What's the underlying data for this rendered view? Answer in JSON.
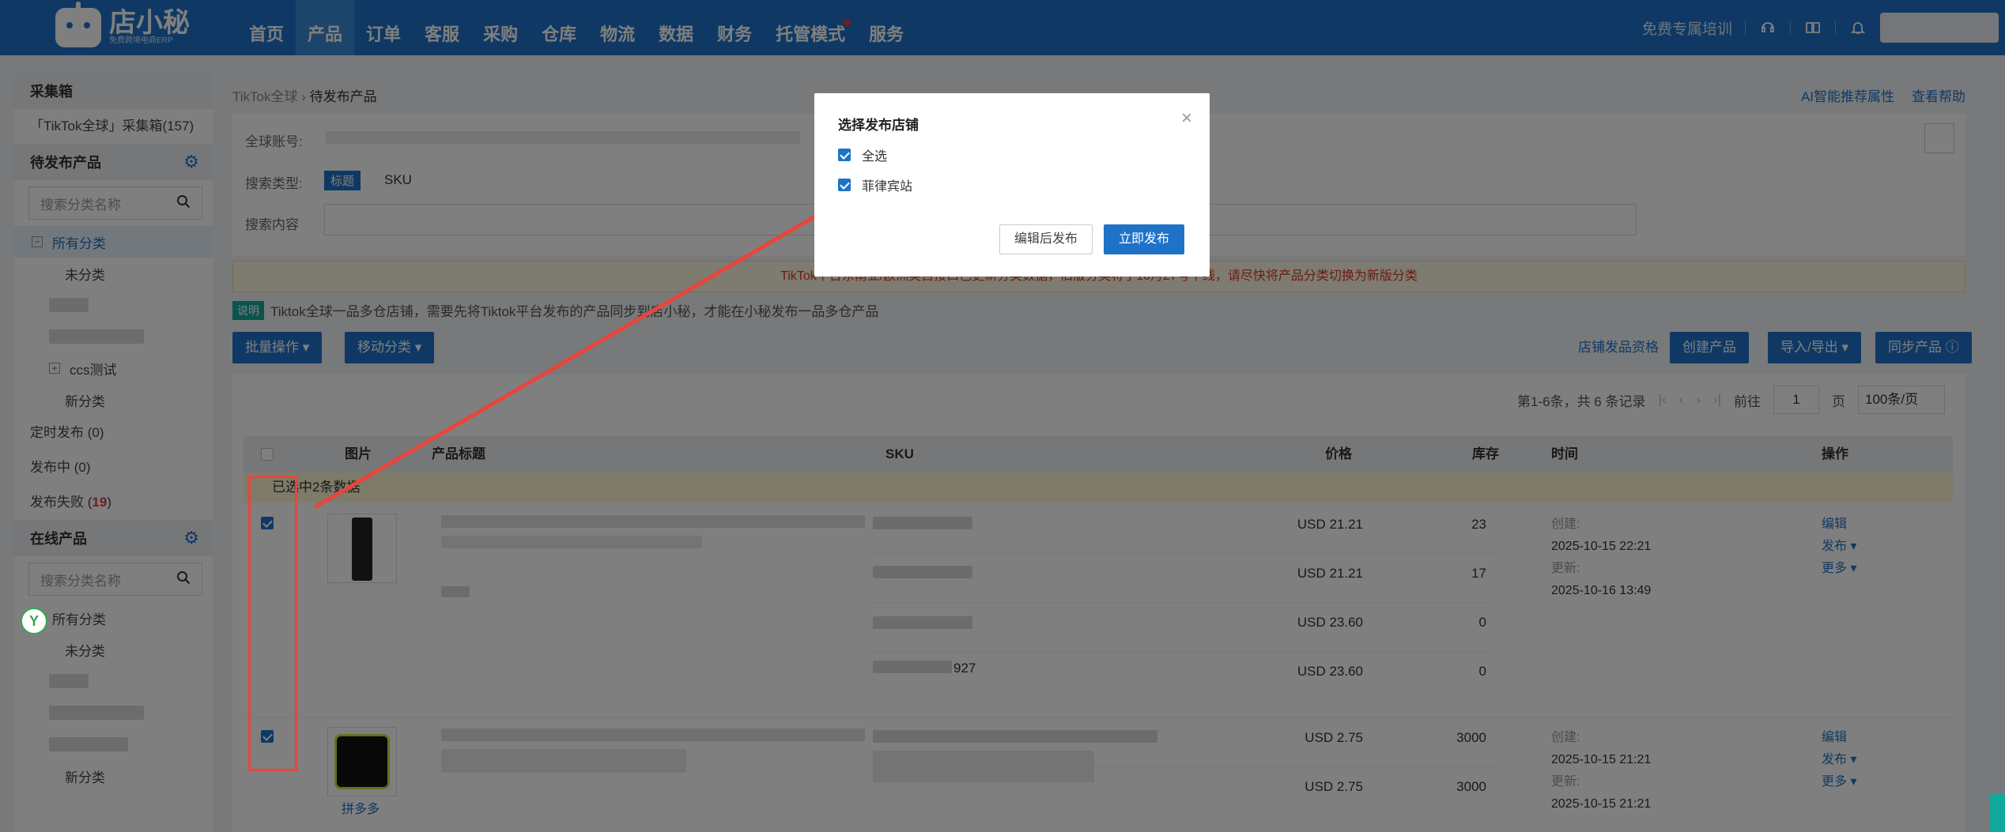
{
  "app": {
    "logo_text": "店小秘",
    "logo_sub": "免费跨境电商ERP"
  },
  "nav": {
    "items": [
      "首页",
      "产品",
      "订单",
      "客服",
      "采购",
      "仓库",
      "物流",
      "数据",
      "财务",
      "托管模式",
      "服务"
    ],
    "active": "产品",
    "training": "免费专属培训"
  },
  "sidebar": {
    "collect_title": "采集箱",
    "collect_item": "「TikTok全球」采集箱(157)",
    "pending_title": "待发布产品",
    "search_placeholder": "搜索分类名称",
    "pending_tree": [
      "所有分类",
      "未分类",
      "ccs测试",
      "新分类"
    ],
    "scheduled": "定时发布 (0)",
    "publishing": "发布中 (0)",
    "failed_label": "发布失败 (",
    "failed_count": "19",
    "failed_close": ")",
    "online_title": "在线产品",
    "online_tree": [
      "所有分类",
      "未分类",
      "新分类"
    ]
  },
  "breadcrumb": {
    "root": "TikTok全球",
    "current": "待发布产品"
  },
  "top_links": {
    "ai": "AI智能推荐属性",
    "help": "查看帮助"
  },
  "filters": {
    "account_label": "全球账号:",
    "search_type_label": "搜索类型:",
    "type_title": "标题",
    "type_sku": "SKU",
    "content_label": "搜索内容"
  },
  "notice": "TikTok平台东南亚/欧洲类目接口已更新分类数据，旧版分类将于10月27号下线，请尽快将产品分类切换为新版分类",
  "tip": {
    "tag": "说明",
    "text": "Tiktok全球一品多仓店铺，需要先将Tiktok平台发布的产品同步到店小秘，才能在小秘发布一品多仓产品"
  },
  "actions": {
    "batch": "批量操作 ▾",
    "move": "移动分类 ▾",
    "shop_qual": "店铺发品资格",
    "create": "创建产品",
    "import_export": "导入/导出 ▾",
    "sync": "同步产品 ⓘ"
  },
  "pager": {
    "summary": "第1-6条，共 6 条记录",
    "goto": "前往",
    "page": "1",
    "page_unit": "页",
    "per_page": "100条/页"
  },
  "table": {
    "headers": {
      "img": "图片",
      "title": "产品标题",
      "sku": "SKU",
      "price": "价格",
      "stock": "库存",
      "time": "时间",
      "ops": "操作"
    },
    "selected_msg": "已选中2条数据",
    "rows": [
      {
        "prices": [
          "USD 21.21",
          "USD 21.21",
          "USD 23.60",
          "USD 23.60"
        ],
        "stocks": [
          "23",
          "17",
          "0",
          "0"
        ],
        "sku_suffix": "927",
        "created_label": "创建:",
        "created": "2025-10-15 22:21",
        "updated_label": "更新:",
        "updated": "2025-10-16 13:49",
        "ops": [
          "编辑",
          "发布 ▾",
          "更多 ▾"
        ]
      },
      {
        "source": "拼多多",
        "prices": [
          "USD 2.75",
          "USD 2.75"
        ],
        "stocks": [
          "3000",
          "3000"
        ],
        "created_label": "创建:",
        "created": "2025-10-15 21:21",
        "updated_label": "更新:",
        "updated": "2025-10-15 21:21",
        "ops": [
          "编辑",
          "发布 ▾",
          "更多 ▾"
        ]
      }
    ]
  },
  "modal": {
    "title": "选择发布店铺",
    "select_all": "全选",
    "shop": "菲律宾站",
    "edit_publish": "编辑后发布",
    "publish_now": "立即发布"
  },
  "colors": {
    "brand": "#1e73c8",
    "annotation": "#e8453c",
    "notice_text": "#d9362b"
  }
}
